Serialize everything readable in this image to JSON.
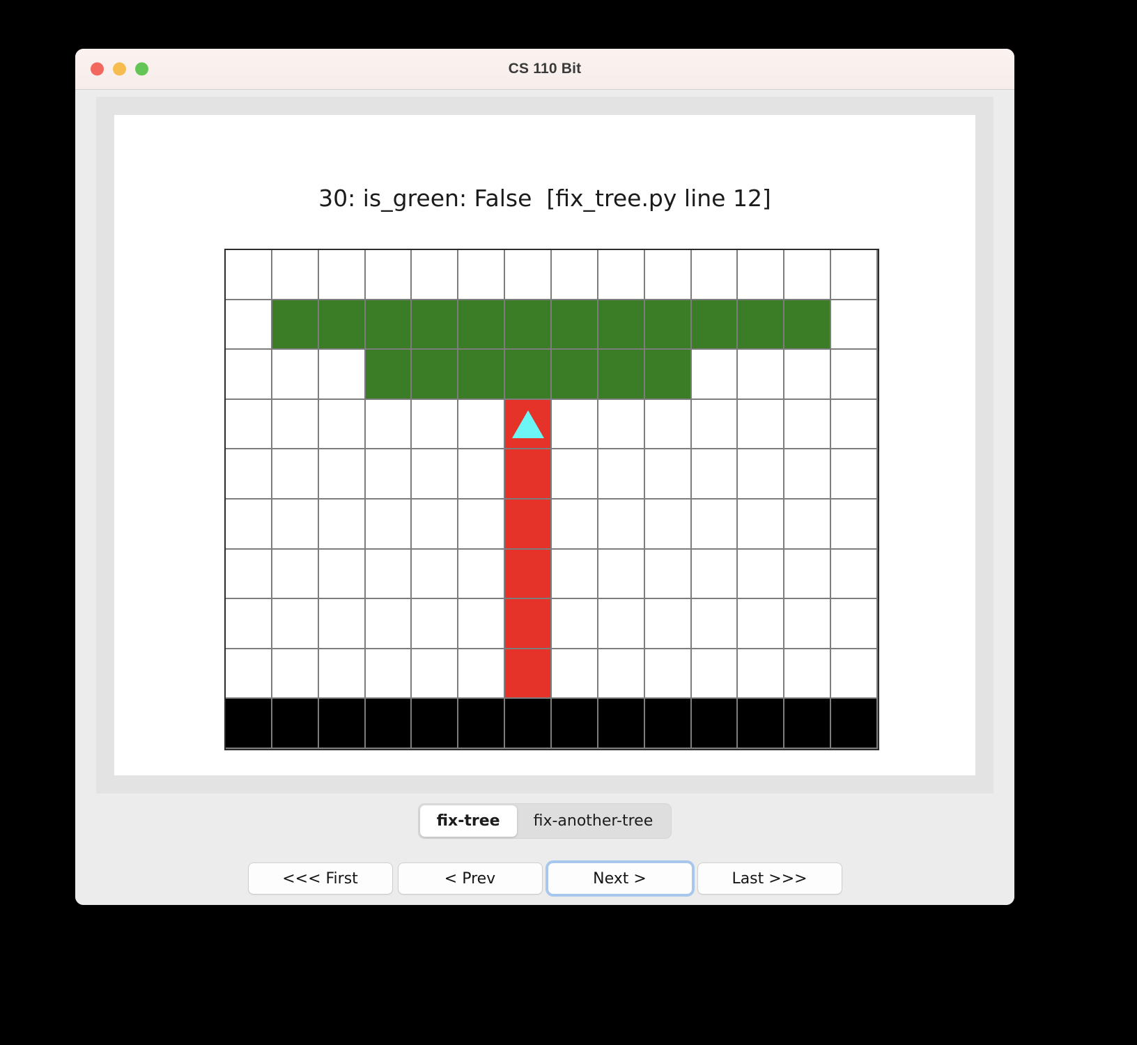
{
  "window": {
    "title": "CS 110 Bit",
    "traffic_lights": [
      {
        "name": "close-button",
        "color": "#f2685e"
      },
      {
        "name": "minimize-button",
        "color": "#f6bc4f"
      },
      {
        "name": "maximize-button",
        "color": "#63c555"
      }
    ]
  },
  "status": {
    "text": "30: is_green: False  [fix_tree.py line 12]",
    "step": "30",
    "expression": "is_green",
    "value": "False",
    "source_file": "fix_tree.py",
    "source_line": "12"
  },
  "segmented_control": {
    "selected": "fix-tree",
    "options": [
      {
        "label": "fix-tree",
        "selected": true
      },
      {
        "label": "fix-another-tree",
        "selected": false
      }
    ]
  },
  "navigation": {
    "buttons": [
      {
        "label": "<<< First",
        "name": "first-button",
        "focused": false
      },
      {
        "label": "< Prev",
        "name": "prev-button",
        "focused": false
      },
      {
        "label": "Next >",
        "name": "next-button",
        "focused": true
      },
      {
        "label": "Last >>>",
        "name": "last-button",
        "focused": false
      }
    ]
  },
  "colors": {
    "green": "#3b7d26",
    "red": "#e6332a",
    "black": "#000000",
    "white": "#ffffff",
    "bird": "#6df5f5",
    "grid_line": "#7d7d7d",
    "grid_border": "#2b2b2b",
    "focus_ring": "#a8c7ec"
  },
  "grid": {
    "columns": 14,
    "rows": 10,
    "bird": {
      "row": 3,
      "col": 6,
      "direction": "up",
      "color": "#6df5f5"
    },
    "cells": [
      [
        "white",
        "white",
        "white",
        "white",
        "white",
        "white",
        "white",
        "white",
        "white",
        "white",
        "white",
        "white",
        "white",
        "white"
      ],
      [
        "white",
        "green",
        "green",
        "green",
        "green",
        "green",
        "green",
        "green",
        "green",
        "green",
        "green",
        "green",
        "green",
        "white"
      ],
      [
        "white",
        "white",
        "white",
        "green",
        "green",
        "green",
        "green",
        "green",
        "green",
        "green",
        "white",
        "white",
        "white",
        "white"
      ],
      [
        "white",
        "white",
        "white",
        "white",
        "white",
        "white",
        "red",
        "white",
        "white",
        "white",
        "white",
        "white",
        "white",
        "white"
      ],
      [
        "white",
        "white",
        "white",
        "white",
        "white",
        "white",
        "red",
        "white",
        "white",
        "white",
        "white",
        "white",
        "white",
        "white"
      ],
      [
        "white",
        "white",
        "white",
        "white",
        "white",
        "white",
        "red",
        "white",
        "white",
        "white",
        "white",
        "white",
        "white",
        "white"
      ],
      [
        "white",
        "white",
        "white",
        "white",
        "white",
        "white",
        "red",
        "white",
        "white",
        "white",
        "white",
        "white",
        "white",
        "white"
      ],
      [
        "white",
        "white",
        "white",
        "white",
        "white",
        "white",
        "red",
        "white",
        "white",
        "white",
        "white",
        "white",
        "white",
        "white"
      ],
      [
        "white",
        "white",
        "white",
        "white",
        "white",
        "white",
        "red",
        "white",
        "white",
        "white",
        "white",
        "white",
        "white",
        "white"
      ],
      [
        "black",
        "black",
        "black",
        "black",
        "black",
        "black",
        "black",
        "black",
        "black",
        "black",
        "black",
        "black",
        "black",
        "black"
      ]
    ]
  }
}
